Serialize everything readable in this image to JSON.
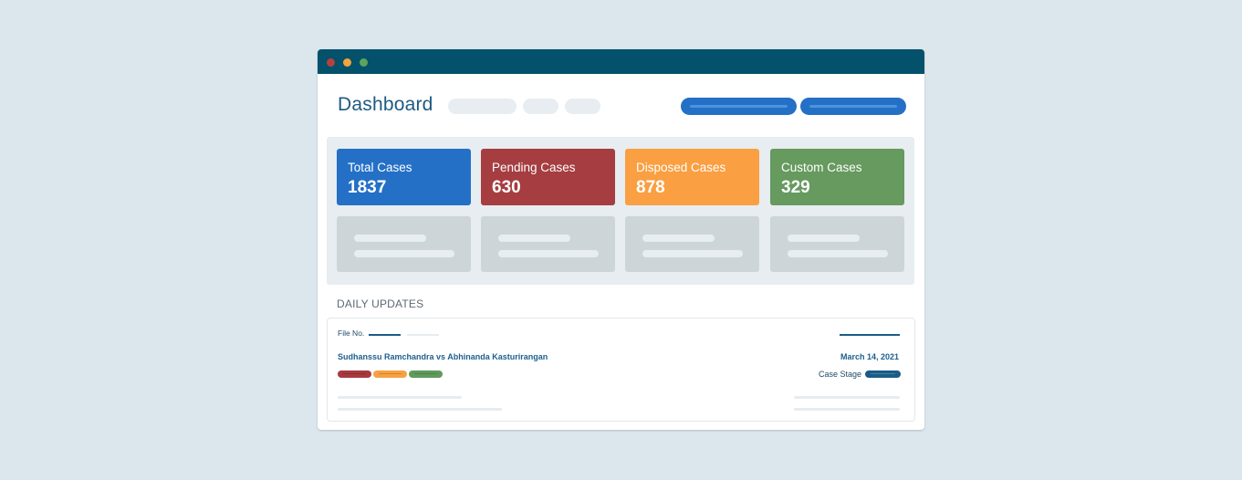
{
  "window": {
    "controls": [
      "close",
      "minimize",
      "maximize"
    ]
  },
  "header": {
    "title": "Dashboard",
    "colors": {
      "titlebar": "#04516c",
      "accent": "#2470c6"
    }
  },
  "stats": [
    {
      "label": "Total Cases",
      "value": "1837",
      "color": "#2470c6"
    },
    {
      "label": "Pending Cases",
      "value": "630",
      "color": "#a63d40"
    },
    {
      "label": "Disposed Cases",
      "value": "878",
      "color": "#fa9f42"
    },
    {
      "label": "Custom Cases",
      "value": "329",
      "color": "#669a5e"
    }
  ],
  "daily_updates": {
    "section_title": "DAILY UPDATES",
    "item": {
      "file_label": "File No.",
      "case_title": "Sudhanssu Ramchandra vs Abhinanda Kasturirangan",
      "date": "March 14, 2021",
      "stage_label": "Case Stage",
      "tags": [
        {
          "color": "#a73a3e"
        },
        {
          "color": "#f6a244"
        },
        {
          "color": "#5f9a5b"
        }
      ]
    }
  }
}
